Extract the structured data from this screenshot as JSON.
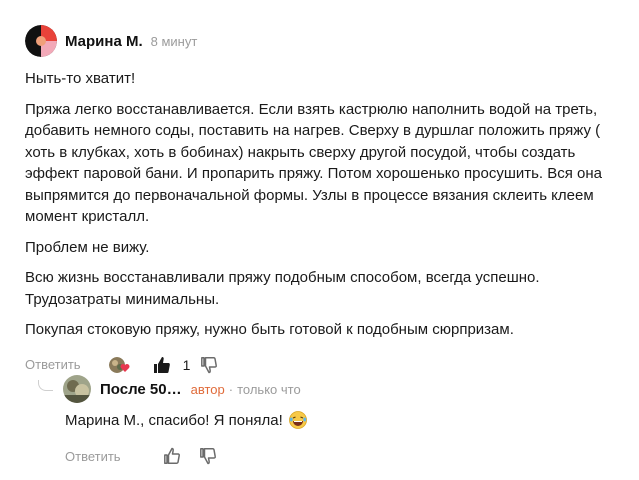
{
  "comment": {
    "author": "Марина М.",
    "time": "8 минут",
    "paragraphs": [
      "Ныть-то хватит!",
      "Пряжа легко восстанавливается. Если взять кастрюлю наполнить водой на треть, добавить немного соды, поставить на нагрев. Сверху в дуршлаг положить пряжу ( хоть в клубках, хоть в бобинах) накрыть сверху другой посудой, чтобы создать эффект паровой бани. И пропарить пряжу. Потом хорошенько просушить. Вся она выпрямится до первоначальной формы. Узлы в процессе вязания склеить клеем момент кристалл.",
      "Проблем не вижу.",
      "Всю жизнь восстанавливали пряжу подобным способом, всегда успешно. Трудозатраты минимальны.",
      "Покупая стоковую пряжу, нужно быть готовой к подобным сюрпризам."
    ],
    "reply_label": "Ответить",
    "like_count": "1",
    "liked": true
  },
  "reply": {
    "author": "После 50…",
    "badge": "автор",
    "separator": "·",
    "time": "только что",
    "text": "Марина М., спасибо! Я поняла!",
    "reply_label": "Ответить"
  },
  "colors": {
    "accent_badge": "#e06b3a",
    "muted": "#9b9b9b",
    "heart": "#e8384f"
  },
  "icons": [
    "avatar-logo-icon",
    "reaction-avatar",
    "heart-icon",
    "thumbs-up-icon",
    "thumbs-down-icon",
    "laughing-emoji-icon"
  ]
}
